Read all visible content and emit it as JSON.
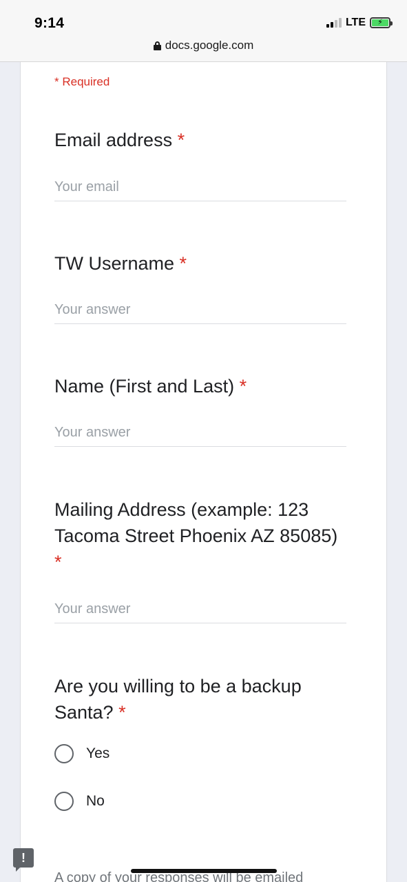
{
  "status_bar": {
    "time": "9:14",
    "network": "LTE"
  },
  "url_bar": {
    "domain": "docs.google.com",
    "lock_icon": "lock-icon"
  },
  "form": {
    "required_note": "* Required",
    "questions": [
      {
        "title": "Email address",
        "required_mark": "*",
        "placeholder": "Your email"
      },
      {
        "title": "TW Username",
        "required_mark": "*",
        "placeholder": "Your answer"
      },
      {
        "title": "Name (First and Last)",
        "required_mark": "*",
        "placeholder": "Your answer"
      },
      {
        "title": "Mailing Address (example: 123 Tacoma Street Phoenix AZ 85085)",
        "required_mark": "*",
        "placeholder": "Your answer"
      },
      {
        "title": "Are you willing to be a backup Santa?",
        "required_mark": "*",
        "options": [
          "Yes",
          "No"
        ]
      }
    ],
    "footer_text": "A copy of your responses will be emailed"
  },
  "colors": {
    "required_red": "#d93025",
    "card_background": "#ffffff",
    "page_background": "#eceef4"
  }
}
